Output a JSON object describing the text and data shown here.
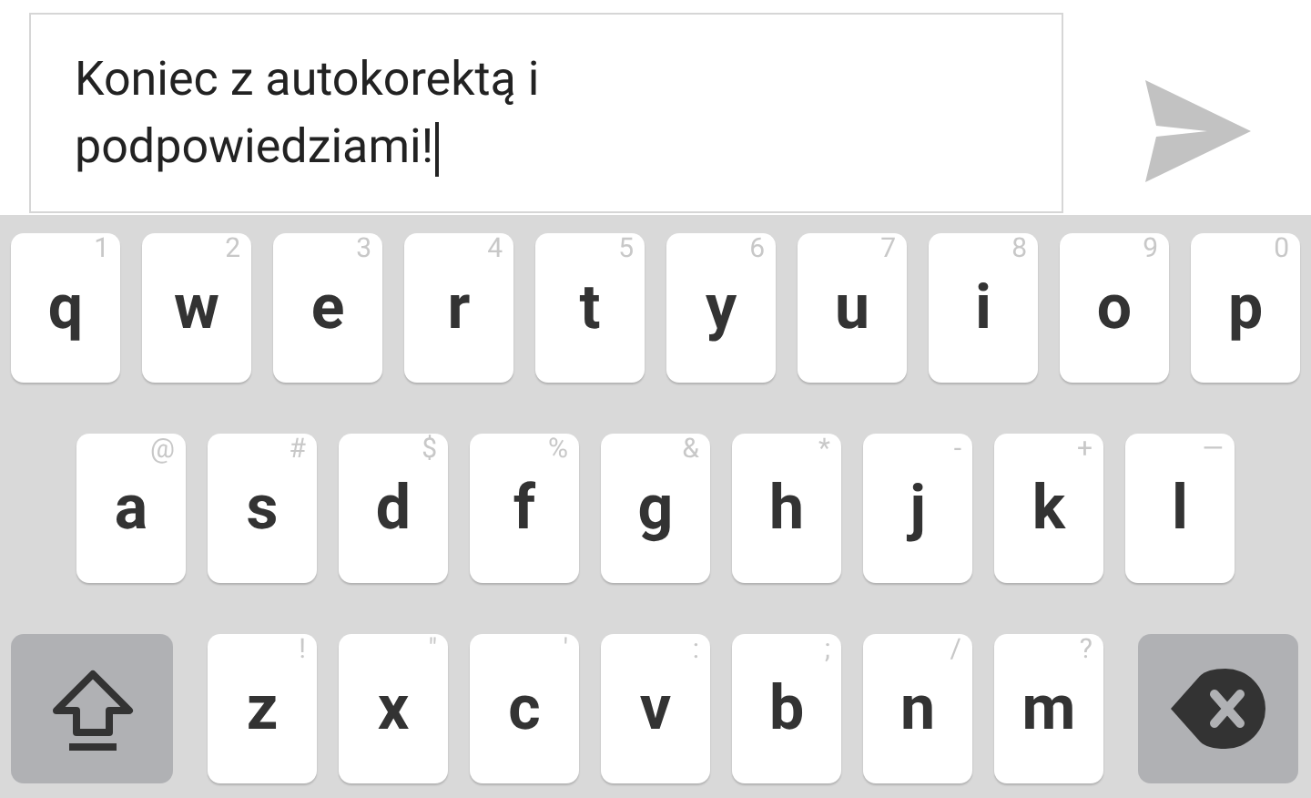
{
  "message_field": {
    "value": "Koniec z autokorektą i podpowiedziami!"
  },
  "keyboard": {
    "rows": [
      [
        {
          "label": "q",
          "hint": "1"
        },
        {
          "label": "w",
          "hint": "2"
        },
        {
          "label": "e",
          "hint": "3"
        },
        {
          "label": "r",
          "hint": "4"
        },
        {
          "label": "t",
          "hint": "5"
        },
        {
          "label": "y",
          "hint": "6"
        },
        {
          "label": "u",
          "hint": "7"
        },
        {
          "label": "i",
          "hint": "8"
        },
        {
          "label": "o",
          "hint": "9"
        },
        {
          "label": "p",
          "hint": "0"
        }
      ],
      [
        {
          "label": "a",
          "hint": "@"
        },
        {
          "label": "s",
          "hint": "#"
        },
        {
          "label": "d",
          "hint": "$"
        },
        {
          "label": "f",
          "hint": "%"
        },
        {
          "label": "g",
          "hint": "&"
        },
        {
          "label": "h",
          "hint": "*"
        },
        {
          "label": "j",
          "hint": "-"
        },
        {
          "label": "k",
          "hint": "+"
        },
        {
          "label": "l",
          "hint": "—"
        }
      ],
      [
        {
          "label": "z",
          "hint": "!"
        },
        {
          "label": "x",
          "hint": "\""
        },
        {
          "label": "c",
          "hint": "'"
        },
        {
          "label": "v",
          "hint": ":"
        },
        {
          "label": "b",
          "hint": ";"
        },
        {
          "label": "n",
          "hint": "/"
        },
        {
          "label": "m",
          "hint": "?"
        }
      ]
    ]
  }
}
